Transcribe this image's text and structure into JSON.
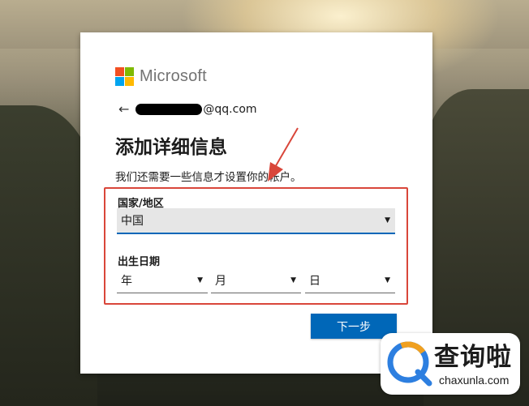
{
  "colors": {
    "primary_button": "#0067b8",
    "highlight_border": "#d9463a",
    "ms_red": "#f25022",
    "ms_green": "#7fba00",
    "ms_blue": "#00a4ef",
    "ms_yellow": "#ffb900"
  },
  "brand": {
    "name": "Microsoft"
  },
  "identity": {
    "back_icon": "back-arrow-icon",
    "email_suffix": "@qq.com"
  },
  "page": {
    "title": "添加详细信息",
    "description": "我们还需要一些信息才设置你的帐户。"
  },
  "form": {
    "country_label": "国家/地区",
    "country_value": "中国",
    "dob_label": "出生日期",
    "year_value": "年",
    "month_value": "月",
    "day_value": "日"
  },
  "actions": {
    "next_label": "下一步"
  },
  "watermark": {
    "name_cn": "查询啦",
    "url": "chaxunla.com",
    "icon": "magnifier-q-icon"
  }
}
